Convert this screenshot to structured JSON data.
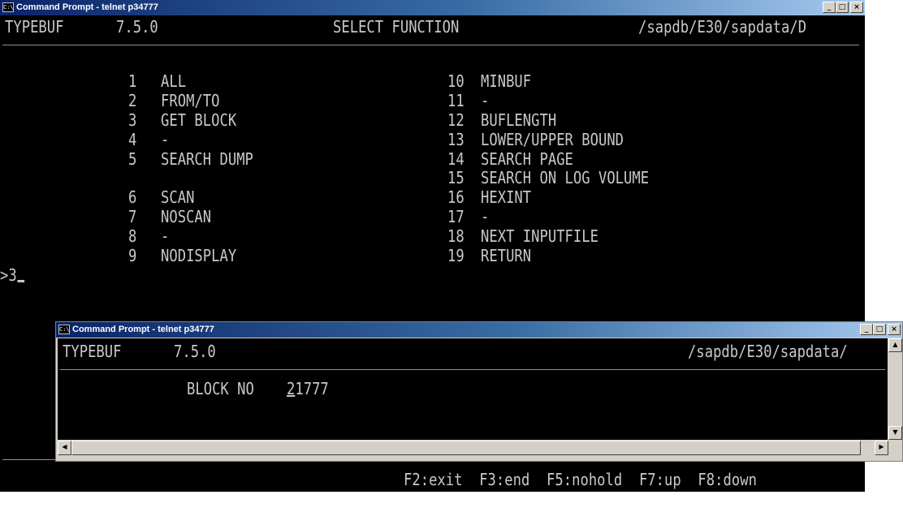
{
  "main_window": {
    "title": "Command Prompt - telnet p34777",
    "header": {
      "program": "TYPEBUF",
      "version": "7.5.0",
      "screen": "SELECT FUNCTION",
      "path": "/sapdb/E30/sapdata/D"
    },
    "menu_left": [
      {
        "num": "1",
        "label": "ALL"
      },
      {
        "num": "2",
        "label": "FROM/TO"
      },
      {
        "num": "3",
        "label": "GET BLOCK"
      },
      {
        "num": "4",
        "label": "-"
      },
      {
        "num": "5",
        "label": "SEARCH DUMP"
      },
      {
        "num": "6",
        "label": "SCAN"
      },
      {
        "num": "7",
        "label": "NOSCAN"
      },
      {
        "num": "8",
        "label": "-"
      },
      {
        "num": "9",
        "label": "NODISPLAY"
      }
    ],
    "menu_right": [
      {
        "num": "10",
        "label": "MINBUF"
      },
      {
        "num": "11",
        "label": "-"
      },
      {
        "num": "12",
        "label": "BUFLENGTH"
      },
      {
        "num": "13",
        "label": "LOWER/UPPER BOUND"
      },
      {
        "num": "14",
        "label": "SEARCH PAGE"
      },
      {
        "num": "15",
        "label": "SEARCH ON LOG VOLUME"
      },
      {
        "num": "16",
        "label": "HEXINT"
      },
      {
        "num": "17",
        "label": "-"
      },
      {
        "num": "18",
        "label": "NEXT INPUTFILE"
      },
      {
        "num": "19",
        "label": "RETURN"
      }
    ],
    "prompt": ">3",
    "function_keys": "F2:exit  F3:end  F5:nohold  F7:up  F8:down"
  },
  "dialog_window": {
    "title": "Command Prompt - telnet p34777",
    "header": {
      "program": "TYPEBUF",
      "version": "7.5.0",
      "path": "/sapdb/E30/sapdata/"
    },
    "field_label": "BLOCK NO",
    "field_value_first": "2",
    "field_value_rest": "1777"
  },
  "window_controls": {
    "minimize": "_",
    "maximize": "□",
    "close": "×"
  },
  "icons": {
    "console": "console-icon"
  }
}
